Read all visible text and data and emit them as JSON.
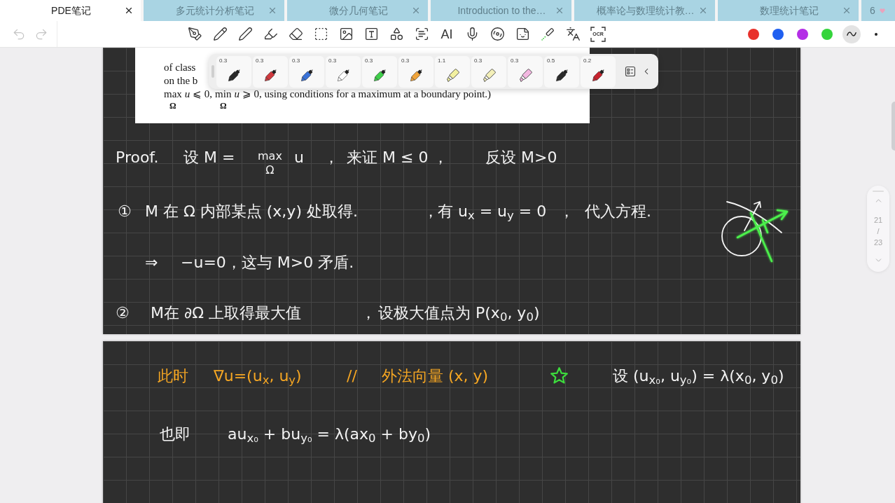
{
  "tabs": [
    {
      "kind": "tab",
      "label": "PDE笔记",
      "selected": true
    },
    {
      "kind": "tab",
      "label": "多元统计分析笔记",
      "selected": false
    },
    {
      "kind": "tab",
      "label": "微分几何笔记",
      "selected": false
    },
    {
      "kind": "tab",
      "label": "Introduction to the…",
      "selected": false
    },
    {
      "kind": "tab",
      "label": "概率论与数理统计教…",
      "selected": false
    },
    {
      "kind": "tab",
      "label": "数理统计笔记",
      "selected": false
    },
    {
      "kind": "cut",
      "label": "6",
      "selected": false
    }
  ],
  "toolbar": {
    "undo": {
      "disabled": true
    },
    "redo": {
      "disabled": true
    },
    "ai_label": "AI",
    "ocr_label": "OCR",
    "colors": [
      {
        "color": "#e8312b",
        "selected": false
      },
      {
        "color": "#1f5ff0",
        "selected": false
      },
      {
        "color": "#b42ee6",
        "selected": false
      },
      {
        "color": "#34d43b",
        "selected": false
      }
    ],
    "stroke_styles": [
      {
        "kind": "wave",
        "selected": true
      },
      {
        "kind": "dot",
        "selected": false
      }
    ]
  },
  "pen_palette": {
    "pens": [
      {
        "kind": "pen",
        "size": "0.3",
        "color": "#2a2a2a"
      },
      {
        "kind": "pen",
        "size": "0.3",
        "color": "#d0393e"
      },
      {
        "kind": "pen",
        "size": "0.3",
        "color": "#3a72d8"
      },
      {
        "kind": "pen",
        "size": "0.3",
        "color": "#ffffff"
      },
      {
        "kind": "pen",
        "size": "0.3",
        "color": "#3fcf4a"
      },
      {
        "kind": "pen",
        "size": "0.3",
        "color": "#f0a43a"
      },
      {
        "kind": "highlighter",
        "size": "1.1",
        "color": "#f2f0a0"
      },
      {
        "kind": "highlighter",
        "size": "0.3",
        "color": "#f3efb8"
      },
      {
        "kind": "highlighter",
        "size": "0.3",
        "color": "#f2b7e0"
      },
      {
        "kind": "pen",
        "size": "0.5",
        "color": "#2a2a2a"
      },
      {
        "kind": "pen",
        "size": "0.2",
        "color": "#c8232e"
      }
    ]
  },
  "pages": [
    {
      "excerpt": {
        "lines": [
          "of class",
          "on the b"
        ],
        "formula": [
          {
            "kind": "stack",
            "text": "max",
            "sub": "Ω"
          },
          {
            "kind": "text",
            "text": "*u* ⩽ 0,"
          },
          {
            "kind": "stack",
            "text": "min",
            "sub": "Ω"
          },
          {
            "kind": "text",
            "text": "*u* ⩾ 0, using conditions for a maximum at a boundary point.)"
          }
        ]
      },
      "lines": [
        {
          "parts": [
            {
              "kind": "text",
              "text": "Proof.",
              "color": "#f2f2f2"
            },
            {
              "kind": "text",
              "text": "设 M =",
              "color": "#f2f2f2"
            },
            {
              "kind": "stack",
              "text": "max",
              "sub": "Ω",
              "color": "#f2f2f2"
            },
            {
              "kind": "text",
              "text": "u",
              "color": "#f2f2f2"
            },
            {
              "kind": "text",
              "text": "，",
              "color": "#f2f2f2"
            },
            {
              "kind": "text",
              "text": "来证 M ≤ 0 ，",
              "color": "#f2f2f2"
            },
            {
              "kind": "text",
              "text": "反设 M>0",
              "color": "#f2f2f2"
            }
          ]
        },
        {
          "parts": [
            {
              "kind": "text",
              "text": "①",
              "color": "#f2f2f2"
            },
            {
              "kind": "text",
              "text": "M 在 Ω 内部某点 (x,y) 处取得.",
              "color": "#f2f2f2"
            },
            {
              "kind": "text",
              "text": "，",
              "color": "#f2f2f2"
            },
            {
              "kind": "text",
              "text": "有 u$_{x}$ = u$_{y}$ = 0",
              "color": "#f2f2f2"
            },
            {
              "kind": "text",
              "text": "，",
              "color": "#f2f2f2"
            },
            {
              "kind": "text",
              "text": "代入方程.",
              "color": "#f2f2f2"
            }
          ]
        },
        {
          "parts": [
            {
              "kind": "text",
              "text": "⇒",
              "color": "#f2f2f2"
            },
            {
              "kind": "text",
              "text": "−u=0，这与 M>0 矛盾.",
              "color": "#f2f2f2"
            }
          ]
        },
        {
          "parts": [
            {
              "kind": "text",
              "text": "②",
              "color": "#f2f2f2"
            },
            {
              "kind": "text",
              "text": "M在 ∂Ω 上取得最大值",
              "color": "#f2f2f2"
            },
            {
              "kind": "text",
              "text": "，",
              "color": "#f2f2f2"
            },
            {
              "kind": "text",
              "text": "设极大值点为 P(x$_{0}$, y$_{0}$)",
              "color": "#f2f2f2"
            }
          ]
        }
      ]
    },
    {
      "lines": [
        {
          "parts": [
            {
              "kind": "text",
              "text": "此时",
              "color": "#f5a623"
            },
            {
              "kind": "text",
              "text": "∇u=(u$_{x}$, u$_{y}$)",
              "color": "#f5a623"
            },
            {
              "kind": "text",
              "text": "//",
              "color": "#f5a623"
            },
            {
              "kind": "text",
              "text": "外法向量 (x, y)",
              "color": "#f5a623"
            },
            {
              "kind": "star",
              "color": "#3ddc3d"
            },
            {
              "kind": "text",
              "text": "设 (u$_{x₀}$, u$_{y₀}$) = λ(x$_{0}$, y$_{0}$)",
              "color": "#f2f2f2"
            }
          ]
        },
        {
          "parts": [
            {
              "kind": "text",
              "text": "也即",
              "color": "#f2f2f2"
            },
            {
              "kind": "text",
              "text": "au$_{x₀}$ + bu$_{y₀}$ = λ(ax$_{0}$ + by$_{0}$)",
              "color": "#f2f2f2"
            }
          ]
        }
      ]
    }
  ],
  "page_nav": {
    "current": "21",
    "separator": "/",
    "total": "23"
  }
}
